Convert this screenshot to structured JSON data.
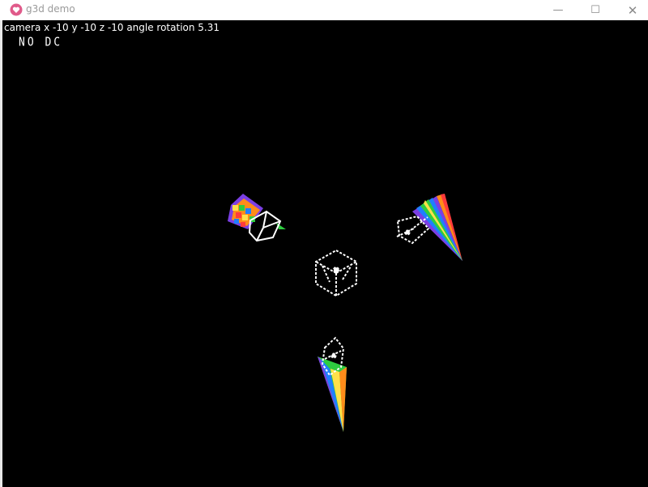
{
  "window": {
    "title": "g3d demo",
    "icon": "heart-app-icon",
    "controls": {
      "minimize": "—",
      "maximize": "☐",
      "close": "✕"
    }
  },
  "hud": {
    "status_text": "camera x -10 y -10 z -10 angle rotation 5.31",
    "dc_text": "NO DC"
  },
  "colors": {
    "background": "#000000",
    "hud_text": "#ffffff",
    "rainbow": [
      "#ff3b3b",
      "#ff8c1a",
      "#ffe14a",
      "#2ecc40",
      "#1f7fff",
      "#7b3fe4"
    ]
  }
}
